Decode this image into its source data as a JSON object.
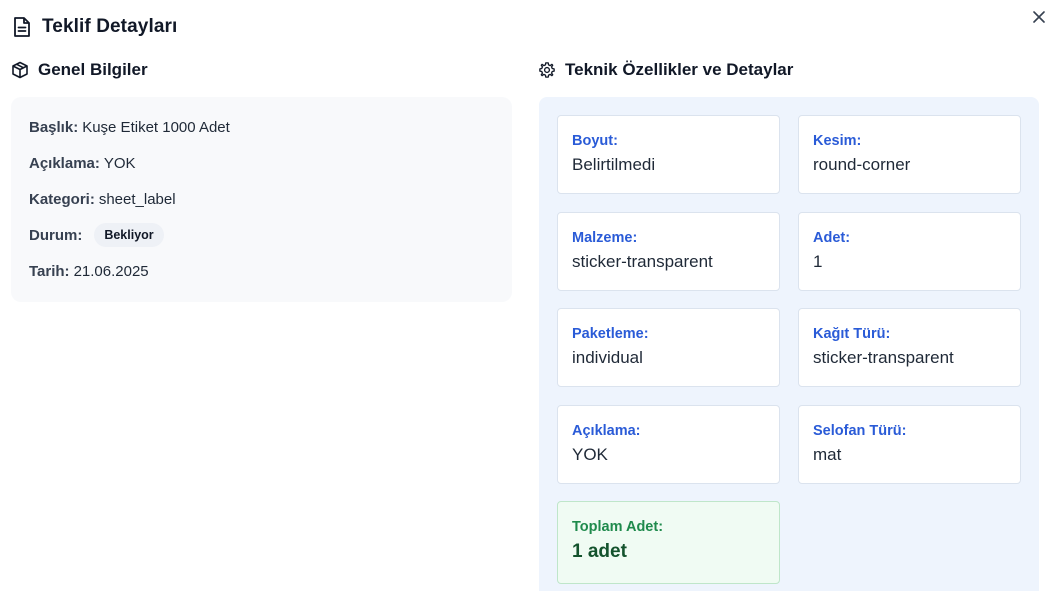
{
  "dialog": {
    "title": "Teklif Detayları"
  },
  "general": {
    "heading": "Genel Bilgiler",
    "rows": [
      {
        "label": "Başlık:",
        "value": "Kuşe Etiket 1000 Adet"
      },
      {
        "label": "Açıklama:",
        "value": "YOK"
      },
      {
        "label": "Kategori:",
        "value": "sheet_label"
      },
      {
        "label": "Durum:",
        "badge": "Bekliyor"
      },
      {
        "label": "Tarih:",
        "value": "21.06.2025"
      }
    ]
  },
  "technical": {
    "heading": "Teknik Özellikler ve Detaylar",
    "cells": [
      {
        "label": "Boyut:",
        "value": "Belirtilmedi"
      },
      {
        "label": "Kesim:",
        "value": "round-corner"
      },
      {
        "label": "Malzeme:",
        "value": "sticker-transparent"
      },
      {
        "label": "Adet:",
        "value": "1"
      },
      {
        "label": "Paketleme:",
        "value": "individual"
      },
      {
        "label": "Kağıt Türü:",
        "value": "sticker-transparent"
      },
      {
        "label": "Açıklama:",
        "value": "YOK"
      },
      {
        "label": "Selofan Türü:",
        "value": "mat"
      }
    ],
    "total": {
      "label": "Toplam Adet:",
      "value": "1 adet"
    }
  },
  "colors": {
    "label_blue": "#2a5bd7",
    "panel_bg": "#eef4fd",
    "total_green": "#1f8a4c"
  },
  "icons": {
    "title": "document-icon",
    "general": "box-icon",
    "technical": "gear-icon",
    "close": "close-icon"
  }
}
